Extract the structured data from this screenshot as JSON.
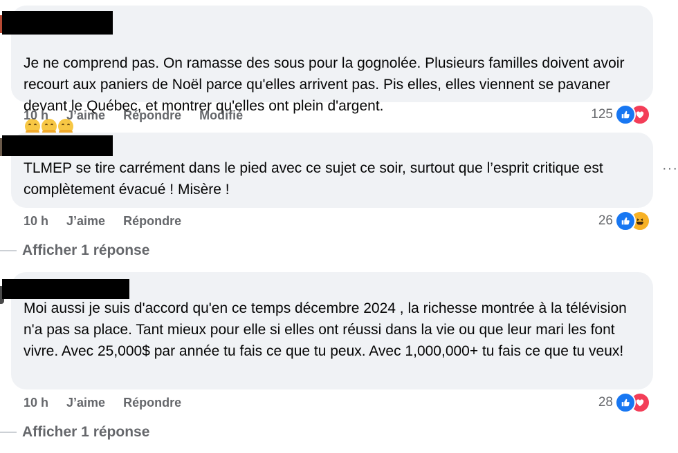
{
  "comments": [
    {
      "text": "Je ne comprend pas. On ramasse des sous pour la gognolée. Plusieurs familles doivent avoir recourt aux paniers de Noël parce qu'elles arrivent pas. Pis elles, elles viennent se pavaner devant le Québec, et montrer qu'elles ont plein d'argent.",
      "emoji": "hugging-face-emoji x3",
      "time": "10 h",
      "like_label": "J’aime",
      "reply_label": "Répondre",
      "edited_label": "Modifié",
      "reaction_count": "125",
      "reactions": [
        "like-icon",
        "love-icon"
      ]
    },
    {
      "text": "TLMEP se tire carrément dans le pied avec ce sujet ce soir, surtout que l’esprit critique est complètement évacué ! Misère !",
      "time": "10 h",
      "like_label": "J’aime",
      "reply_label": "Répondre",
      "reaction_count": "26",
      "reactions": [
        "like-icon",
        "haha-icon"
      ],
      "more_label": "···",
      "show_replies": "Afficher 1 réponse"
    },
    {
      "text": "Moi aussi je suis d'accord qu'en ce temps décembre 2024 , la richesse montrée à la télévision n'a pas sa place. Tant mieux pour elle si elles ont réussi dans la vie ou que leur mari les font vivre. Avec 25,000$ par année tu fais ce que tu peux. Avec 1,000,000+ tu fais ce que tu veux!",
      "time": "10 h",
      "like_label": "J’aime",
      "reply_label": "Répondre",
      "reaction_count": "28",
      "reactions": [
        "like-icon",
        "love-icon"
      ],
      "show_replies": "Afficher 1 réponse"
    }
  ],
  "colors": {
    "bubble": "#f0f2f5",
    "secondary_text": "#65676b",
    "like_blue": "#1877f2",
    "love_red": "#f33e58",
    "haha_yellow": "#f7b125"
  }
}
